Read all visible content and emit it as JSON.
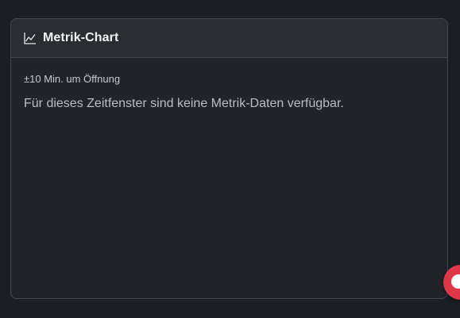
{
  "card": {
    "title": "Metrik-Chart",
    "title_icon": "line-chart-icon",
    "window_label": "±10 Min. um Öffnung",
    "empty_message": "Für dieses Zeitfenster sind keine Metrik-Daten verfügbar."
  },
  "fab": {
    "icon": "chat-bubble-icon",
    "color": "#e0364a"
  },
  "colors": {
    "background": "#1b1e22",
    "card": "#212428",
    "card_header": "#2a2d31",
    "border": "#44484e"
  }
}
